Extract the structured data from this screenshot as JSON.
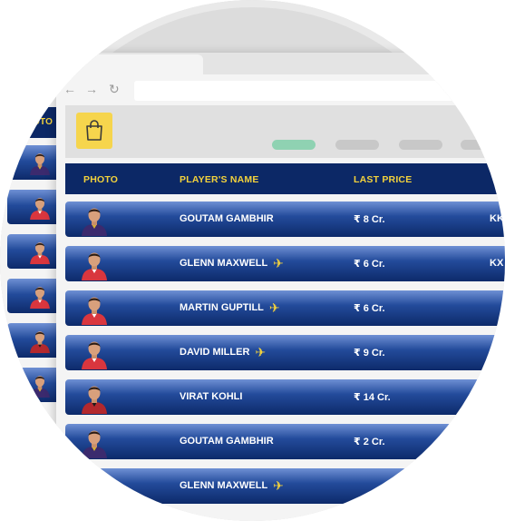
{
  "browser": {
    "nav": {
      "back": "←",
      "forward": "→",
      "reload": "↻"
    }
  },
  "back_window": {
    "header_text": "OTO",
    "rows": [
      {
        "team": "kkr"
      },
      {
        "team": "kxip"
      },
      {
        "team": "kxip"
      },
      {
        "team": "kxip"
      },
      {
        "team": "rcb"
      },
      {
        "team": "kkr"
      }
    ]
  },
  "app": {
    "cart_icon": "shopping-bag-icon",
    "tabs": [
      {
        "active": true
      },
      {
        "active": false
      },
      {
        "active": false
      },
      {
        "active": false
      }
    ]
  },
  "table": {
    "headers": {
      "photo": "PHOTO",
      "name": "PLAYER'S NAME",
      "price": "LAST PRICE"
    },
    "rows": [
      {
        "name": "GOUTAM GAMBHIR",
        "price": "₹ 8 Cr.",
        "team": "KK",
        "overseas": false,
        "kit": "kkr"
      },
      {
        "name": "GLENN MAXWELL",
        "price": "₹ 6 Cr.",
        "team": "KX",
        "overseas": true,
        "kit": "kxip"
      },
      {
        "name": "MARTIN GUPTILL",
        "price": "₹ 6 Cr.",
        "team": "",
        "overseas": true,
        "kit": "kxip"
      },
      {
        "name": "DAVID MILLER",
        "price": "₹ 9 Cr.",
        "team": "",
        "overseas": true,
        "kit": "kxip"
      },
      {
        "name": "VIRAT KOHLI",
        "price": "₹ 14 Cr.",
        "team": "",
        "overseas": false,
        "kit": "rcb"
      },
      {
        "name": "GOUTAM GAMBHIR",
        "price": "₹ 2 Cr.",
        "team": "",
        "overseas": false,
        "kit": "kkr"
      },
      {
        "name": "GLENN MAXWELL",
        "price": "",
        "team": "",
        "overseas": true,
        "kit": "kxip"
      }
    ]
  },
  "colors": {
    "header_bg": "#0c2866",
    "header_text": "#f3d23c",
    "row_top": "#6f90d4",
    "row_bottom": "#0d2a6a",
    "cart_bg": "#f6d54d",
    "active_tab": "#8fd2b2"
  }
}
